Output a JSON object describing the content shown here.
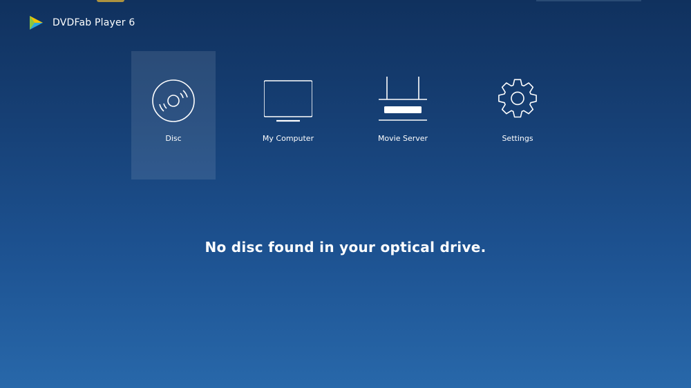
{
  "app": {
    "title": "DVDFab Player 6"
  },
  "nav": {
    "items": [
      {
        "label": "Disc",
        "icon": "disc-icon",
        "active": true
      },
      {
        "label": "My Computer",
        "icon": "monitor-icon",
        "active": false
      },
      {
        "label": "Movie Server",
        "icon": "router-icon",
        "active": false
      },
      {
        "label": "Settings",
        "icon": "gear-icon",
        "active": false
      }
    ]
  },
  "status": {
    "message": "No disc found in your optical drive."
  },
  "colors": {
    "background_top": "#10315e",
    "background_bottom": "#2868aa",
    "text": "#ffffff",
    "logo_green": "#8cc63f",
    "logo_yellow": "#f2c200",
    "logo_blue": "#2aa8e0"
  }
}
